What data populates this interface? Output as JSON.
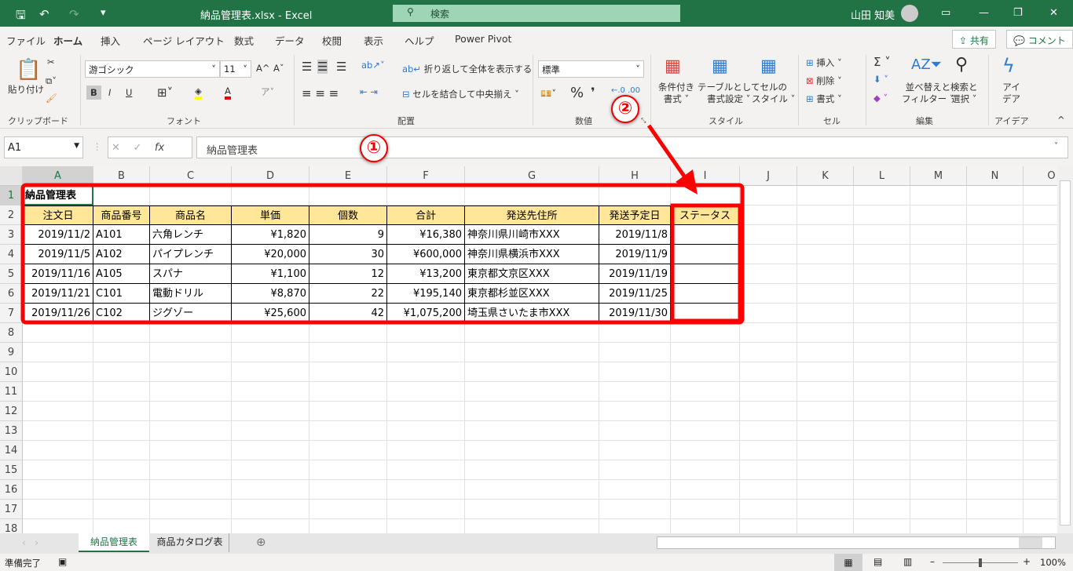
{
  "title": {
    "filename": "納品管理表.xlsx",
    "sep": "-",
    "app": "Excel",
    "search": "検索",
    "user": "山田 知美"
  },
  "tabs": [
    "ファイル",
    "ホーム",
    "挿入",
    "ページ レイアウト",
    "数式",
    "データ",
    "校閲",
    "表示",
    "ヘルプ",
    "Power Pivot"
  ],
  "header_buttons": {
    "share": "共有",
    "comment": "コメント"
  },
  "ribbon": {
    "clipboard": {
      "paste": "貼り付け",
      "group": "クリップボード"
    },
    "font": {
      "name": "游ゴシック",
      "size": "11",
      "group": "フォント",
      "bold": "B",
      "italic": "I",
      "underline": "U"
    },
    "alignment": {
      "wrap": "折り返して全体を表示する",
      "merge": "セルを結合して中央揃え",
      "group": "配置"
    },
    "number": {
      "format": "標準",
      "percent": "%",
      "comma": "❜",
      "group": "数値"
    },
    "styles": {
      "conditional": [
        "条件付き",
        "書式"
      ],
      "table": [
        "テーブルとして",
        "書式設定"
      ],
      "cell": [
        "セルの",
        "スタイル"
      ],
      "group": "スタイル"
    },
    "cells": {
      "insert": "挿入",
      "delete": "削除",
      "format": "書式",
      "group": "セル"
    },
    "editing": {
      "sort": [
        "並べ替えと",
        "フィルター"
      ],
      "find": [
        "検索と",
        "選択"
      ],
      "group": "編集"
    },
    "ideas": {
      "label": [
        "アイ",
        "デア"
      ],
      "group": "アイデア"
    }
  },
  "formula_bar": {
    "name_box": "A1",
    "fx": "fx",
    "value": "納品管理表"
  },
  "columns": [
    "A",
    "B",
    "C",
    "D",
    "E",
    "F",
    "G",
    "H",
    "I",
    "J",
    "K",
    "L",
    "M",
    "N",
    "O"
  ],
  "rows": [
    "1",
    "2",
    "3",
    "4",
    "5",
    "6",
    "7",
    "8",
    "9",
    "10",
    "11",
    "12",
    "13",
    "14",
    "15",
    "16",
    "17",
    "18"
  ],
  "sheet": {
    "title": "納品管理表",
    "headers": [
      "注文日",
      "商品番号",
      "商品名",
      "単価",
      "個数",
      "合計",
      "発送先住所",
      "発送予定日",
      "ステータス"
    ],
    "data": [
      [
        "2019/11/2",
        "A101",
        "六角レンチ",
        "¥1,820",
        "9",
        "¥16,380",
        "神奈川県川崎市XXX",
        "2019/11/8",
        ""
      ],
      [
        "2019/11/5",
        "A102",
        "パイプレンチ",
        "¥20,000",
        "30",
        "¥600,000",
        "神奈川県横浜市XXX",
        "2019/11/9",
        ""
      ],
      [
        "2019/11/16",
        "A105",
        "スパナ",
        "¥1,100",
        "12",
        "¥13,200",
        "東京都文京区XXX",
        "2019/11/19",
        ""
      ],
      [
        "2019/11/21",
        "C101",
        "電動ドリル",
        "¥8,870",
        "22",
        "¥195,140",
        "東京都杉並区XXX",
        "2019/11/25",
        ""
      ],
      [
        "2019/11/26",
        "C102",
        "ジグゾー",
        "¥25,600",
        "42",
        "¥1,075,200",
        "埼玉県さいたま市XXX",
        "2019/11/30",
        ""
      ]
    ]
  },
  "sheet_tabs": [
    "納品管理表",
    "商品カタログ表"
  ],
  "status": {
    "ready": "準備完了",
    "zoom": "100%",
    "zoom_level": 100
  },
  "annotations": {
    "badge1": "①",
    "badge2": "②",
    "color": "#ff0000"
  },
  "colors": {
    "brand": "#217346",
    "header_fill": "#ffe699"
  }
}
